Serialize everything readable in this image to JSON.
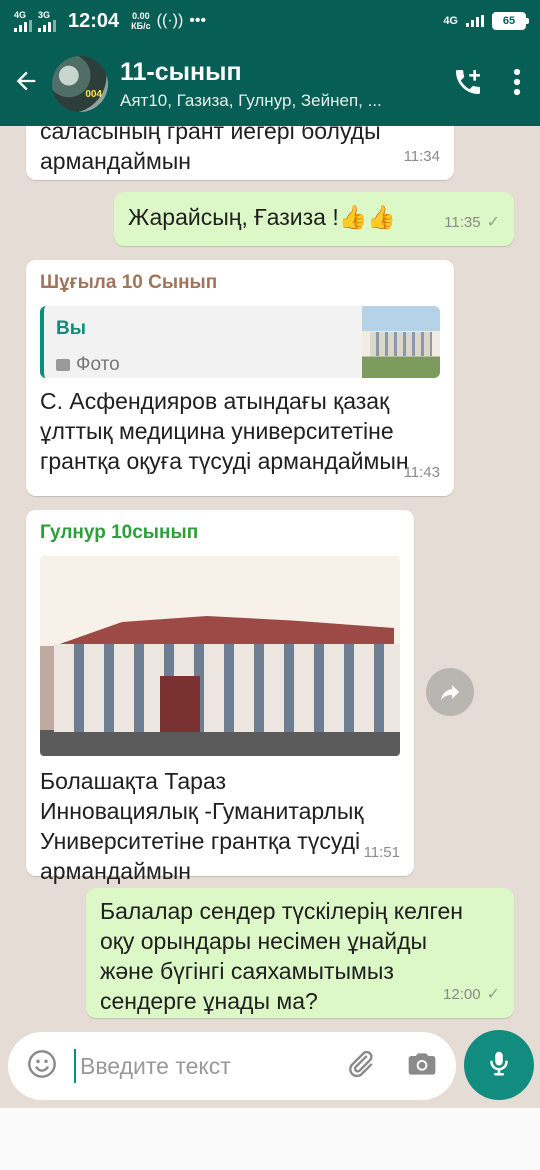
{
  "status": {
    "net1": "4G",
    "net2": "3G",
    "time": "12:04",
    "speed_value": "0.00",
    "speed_unit": "КБ/с",
    "net_right": "4G",
    "battery": "65"
  },
  "header": {
    "title": "11-сынып",
    "subtitle": "Аят10, Газиза, Гулнур, Зейнеп, ...",
    "avatar_text": "004"
  },
  "messages": [
    {
      "text_line1": "саласының грант иегері болуды",
      "text_line2": "армандаймын",
      "time": "11:34"
    },
    {
      "text": "Жарайсың, Ғазиза !👍👍",
      "time": "11:35",
      "status": "✓"
    },
    {
      "sender": "Шұғыла 10 Сынып",
      "quote_name": "Вы",
      "quote_kind": "Фото",
      "text_line1": "С. Асфендияров атындағы қазақ",
      "text_line2": "ұлттық медицина университетіне",
      "text_line3": "грантқа оқуға түсуді армандаймын",
      "time": "11:43"
    },
    {
      "sender": "Гулнур 10сынып",
      "text_line1": "Болашақта Тараз",
      "text_line2": "Инновациялық -Гуманитарлық",
      "text_line3": "Университетіне грантқа түсуді",
      "text_line4": "армандаймын",
      "time": "11:51"
    },
    {
      "text_line1": "Балалар сендер түскілерің келген",
      "text_line2": "оқу орындары несімен ұнайды",
      "text_line3": "және бүгінгі саяхамытымыз",
      "text_line4": "сендерге ұнады ма?",
      "time": "12:00",
      "status": "✓"
    }
  ],
  "input": {
    "placeholder": "Введите текст"
  },
  "colors": {
    "header": "#075e54",
    "outgoing": "#dcf8c6",
    "background": "#e5ddd5",
    "sender1": "#a0755c",
    "sender2": "#2e9e3a",
    "mic": "#128c7e"
  }
}
